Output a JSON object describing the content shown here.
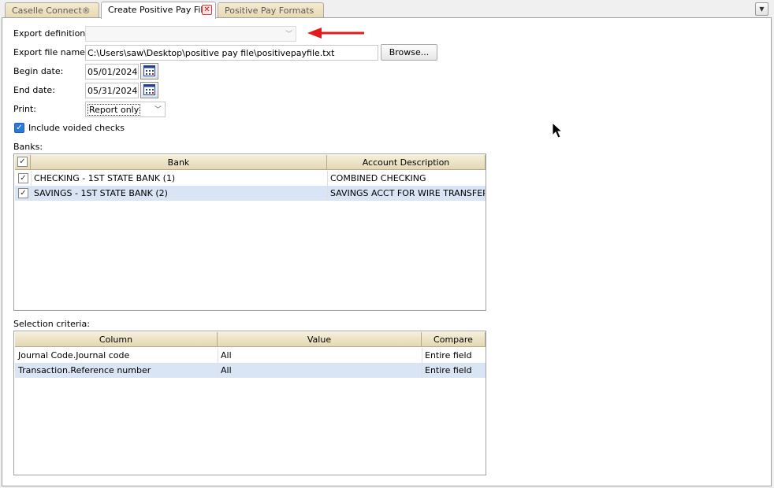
{
  "tabs": [
    {
      "label": "Caselle Connect®",
      "active": false
    },
    {
      "label": "Create Positive Pay File",
      "active": true,
      "closable": true
    },
    {
      "label": "Positive Pay Formats",
      "active": false
    }
  ],
  "tab_menu_icon": "chevron-down-icon",
  "form": {
    "export_definition_label": "Export definition:",
    "export_definition_value": "",
    "export_file_label": "Export file name:",
    "export_file_value": "C:\\Users\\saw\\Desktop\\positive pay file\\positivepayfile.txt",
    "browse_label": "Browse...",
    "begin_date_label": "Begin date:",
    "begin_date_value": "05/01/2024",
    "end_date_label": "End date:",
    "end_date_value": "05/31/2024",
    "print_label": "Print:",
    "print_value": "Report only",
    "include_voided_label": "Include voided checks",
    "include_voided_checked": true
  },
  "banks": {
    "label": "Banks:",
    "columns": [
      "Bank",
      "Account Description"
    ],
    "rows": [
      {
        "checked": true,
        "bank": "CHECKING - 1ST STATE BANK (1)",
        "description": "COMBINED CHECKING",
        "selected": false
      },
      {
        "checked": true,
        "bank": "SAVINGS - 1ST STATE BANK (2)",
        "description": "SAVINGS ACCT FOR WIRE TRANSFER",
        "selected": true
      }
    ]
  },
  "selection": {
    "label": "Selection criteria:",
    "columns": [
      "Column",
      "Value",
      "Compare"
    ],
    "rows": [
      {
        "column": "Journal Code.Journal code",
        "value": "All",
        "compare": "Entire field",
        "selected": false
      },
      {
        "column": "Transaction.Reference number",
        "value": "All",
        "compare": "Entire field",
        "selected": true
      }
    ]
  },
  "colors": {
    "accent_arrow": "#e31b1b",
    "row_selected": "#d9e4f5",
    "header_bg": "#efe5c6"
  }
}
